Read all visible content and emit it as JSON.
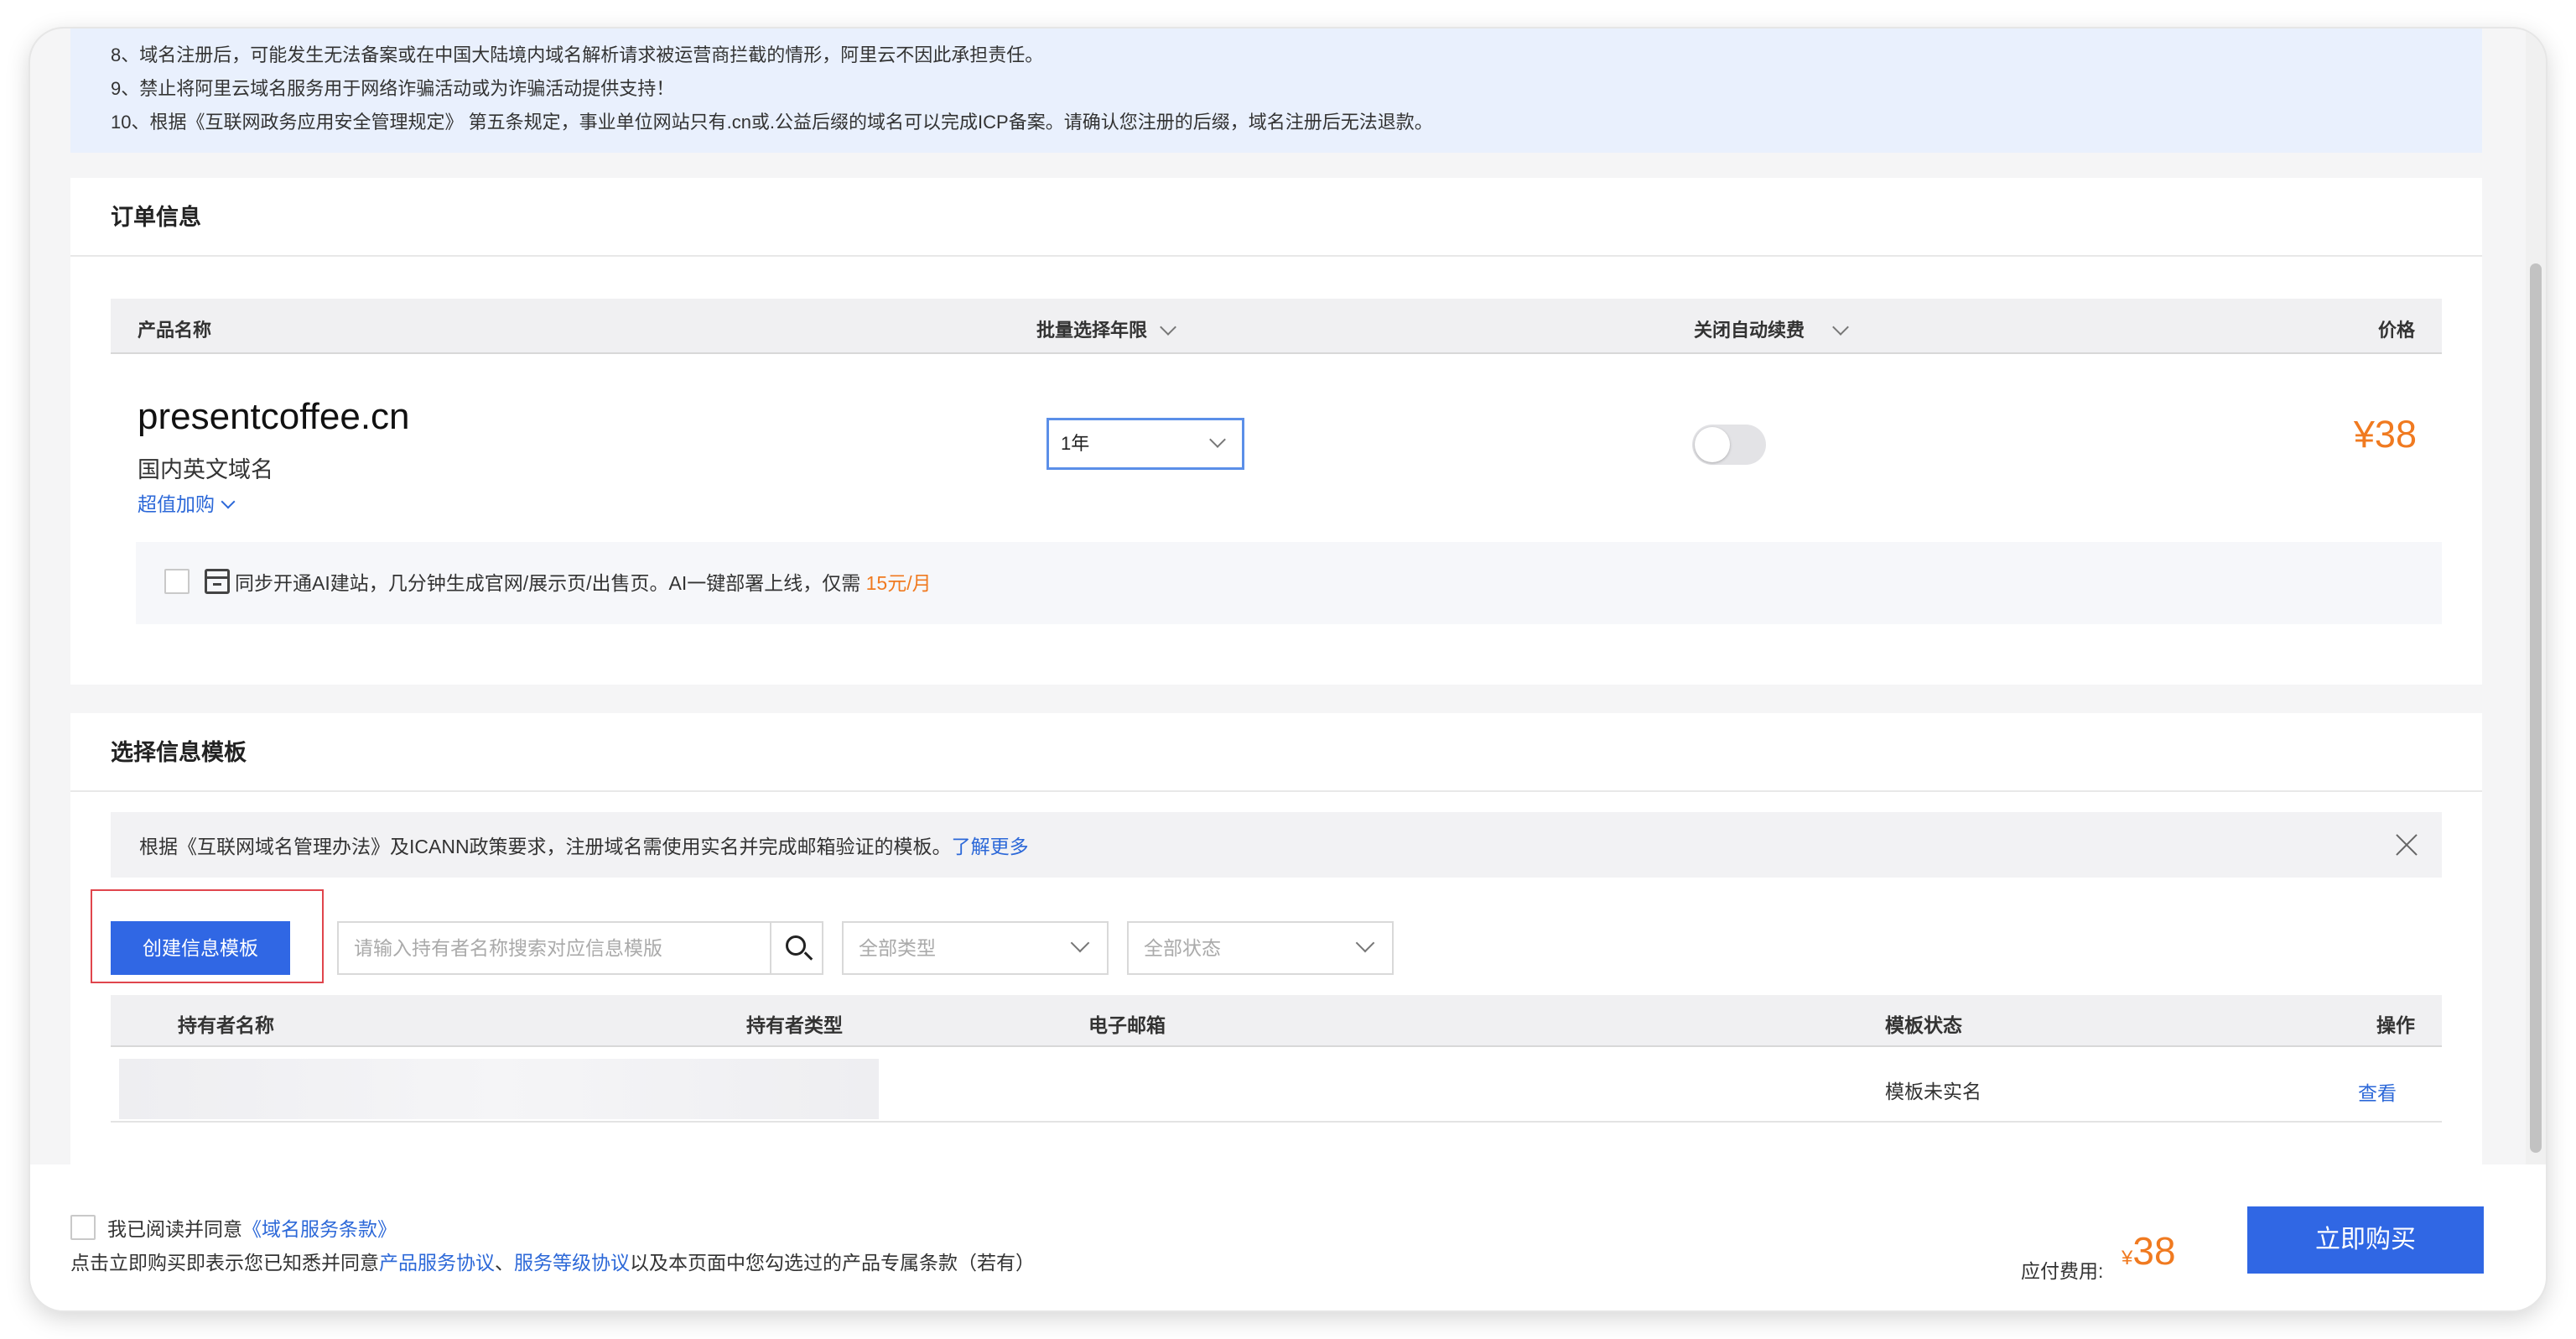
{
  "notice": {
    "lines": [
      "8、域名注册后，可能发生无法备案或在中国大陆境内域名解析请求被运营商拦截的情形，阿里云不因此承担责任。",
      "9、禁止将阿里云域名服务用于网络诈骗活动或为诈骗活动提供支持！",
      "10、根据《互联网政务应用安全管理规定》 第五条规定，事业单位网站只有.cn或.公益后缀的域名可以完成ICP备案。请确认您注册的后缀，域名注册后无法退款。"
    ]
  },
  "order": {
    "title": "订单信息",
    "columns": {
      "product": "产品名称",
      "years": "批量选择年限",
      "auto_renew": "关闭自动续费",
      "price": "价格"
    },
    "item": {
      "domain": "presentcoffee.cn",
      "type": "国内英文域名",
      "addon_link": "超值加购",
      "year_value": "1年",
      "auto_renew_on": false,
      "price": "¥38"
    },
    "ai_offer": {
      "text": "同步开通AI建站，几分钟生成官网/展示页/出售页。AI一键部署上线，仅需 ",
      "price": "15元/月",
      "checked": false
    }
  },
  "template": {
    "title": "选择信息模板",
    "tip": {
      "text": "根据《互联网域名管理办法》及ICANN政策要求，注册域名需使用实名并完成邮箱验证的模板。",
      "link": "了解更多"
    },
    "create_button": "创建信息模板",
    "search_placeholder": "请输入持有者名称搜索对应信息模版",
    "type_filter": "全部类型",
    "status_filter": "全部状态",
    "columns": {
      "holder_name": "持有者名称",
      "holder_type": "持有者类型",
      "email": "电子邮箱",
      "status": "模板状态",
      "action": "操作"
    },
    "rows": [
      {
        "status": "模板未实名",
        "action": "查看"
      }
    ]
  },
  "footer": {
    "agree_prefix": "我已阅读并同意",
    "agree_link": "《域名服务条款》",
    "notice_prefix": "点击立即购买即表示您已知悉并同意",
    "link_product": "产品服务协议",
    "separator": "、",
    "link_sla": "服务等级协议",
    "notice_suffix": "以及本页面中您勾选过的产品专属条款（若有）",
    "pay_label": "应付费用:",
    "pay_currency": "¥",
    "pay_amount": "38",
    "buy_button": "立即购买"
  },
  "colors": {
    "primary": "#3067e4",
    "price": "#f07a20",
    "link": "#2c68d8",
    "notice_bg": "#e9f0fd"
  }
}
